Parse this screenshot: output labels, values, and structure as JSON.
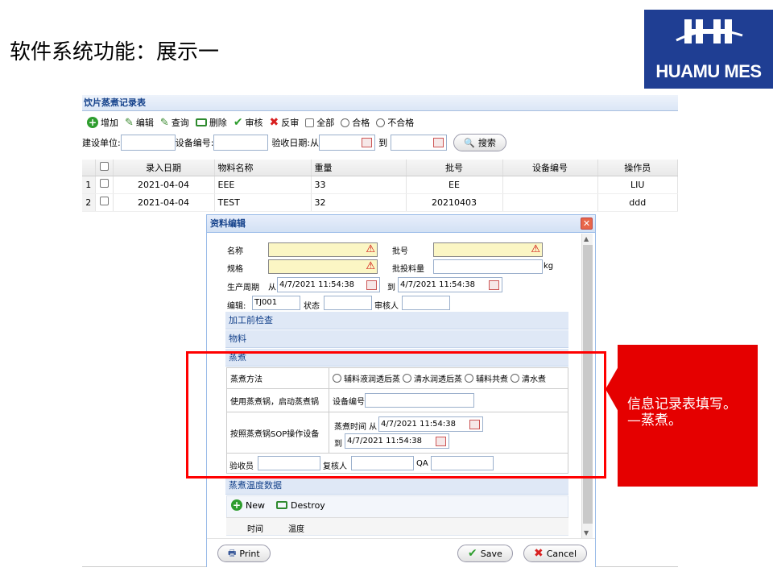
{
  "slide_title": "软件系统功能：展示一",
  "logo": {
    "text": "HUAMU MES"
  },
  "window": {
    "title": "饮片蒸煮记录表",
    "toolbar": {
      "add": "增加",
      "edit": "编辑",
      "query": "查询",
      "delete": "删除",
      "audit": "审核",
      "unaudit": "反审",
      "filter_all": "全部",
      "filter_pass": "合格",
      "filter_fail": "不合格"
    },
    "search": {
      "unit_label": "建设单位:",
      "unit_value": "",
      "device_label": "设备编号:",
      "device_value": "",
      "date_label": "验收日期:从",
      "date_from": "",
      "to_label": "到",
      "date_to": "",
      "search_button": "搜索"
    },
    "grid": {
      "columns": [
        "录入日期",
        "物料名称",
        "重量",
        "批号",
        "设备编号",
        "操作员"
      ],
      "rows": [
        {
          "num": "1",
          "date": "2021-04-04",
          "material": "EEE",
          "weight": "33",
          "batch": "EE",
          "device": "",
          "operator": "LIU"
        },
        {
          "num": "2",
          "date": "2021-04-04",
          "material": "TEST",
          "weight": "32",
          "batch": "20210403",
          "device": "",
          "operator": "ddd"
        }
      ]
    }
  },
  "dialog": {
    "title": "资料编辑",
    "fields": {
      "name_label": "名称",
      "name_value": "",
      "batch_label": "批号",
      "batch_value": "",
      "spec_label": "规格",
      "spec_value": "",
      "feed_label": "批投料量",
      "feed_value": "",
      "feed_unit": "kg",
      "period_label": "生产周期",
      "from_label": "从",
      "period_from": "4/7/2021 11:54:38",
      "period_to_label": "到",
      "period_to": "4/7/2021 11:54:38",
      "code_label": "编辑:",
      "code_value": "TJ001",
      "status_label": "状态",
      "status_value": "",
      "auditor_label": "审核人",
      "auditor_value": ""
    },
    "sections": {
      "preprocess": "加工前检查",
      "material": "物料",
      "steaming": "蒸煮",
      "temperature": "蒸煮温度数据"
    },
    "steaming": {
      "method_label": "蒸煮方法",
      "method_options": [
        "辅料液润透后蒸",
        "清水润透后蒸",
        "辅料共煮",
        "清水煮"
      ],
      "use_label": "使用蒸煮锅，启动蒸煮锅",
      "device_label": "设备编号",
      "device_value": "",
      "sop_label": "按照蒸煮锅SOP操作设备",
      "time_label": "蒸煮时间 从",
      "time_from": "4/7/2021 11:54:38",
      "time_to_label": "到",
      "time_to": "4/7/2021 11:54:38",
      "inspector_label": "验收员",
      "inspector_value": "",
      "reviewer_label": "复核人",
      "reviewer_value": "",
      "qa_label": "QA",
      "qa_value": ""
    },
    "temp_table": {
      "new_button": "New",
      "destroy_button": "Destroy",
      "columns": [
        "时间",
        "温度"
      ]
    },
    "buttons": {
      "print": "Print",
      "save": "Save",
      "cancel": "Cancel"
    }
  },
  "callout": {
    "text": "信息记录表填写。—蒸煮。"
  },
  "colors": {
    "accent": "#15428b",
    "highlight": "#e50000",
    "logo_bg": "#1f3e93"
  }
}
